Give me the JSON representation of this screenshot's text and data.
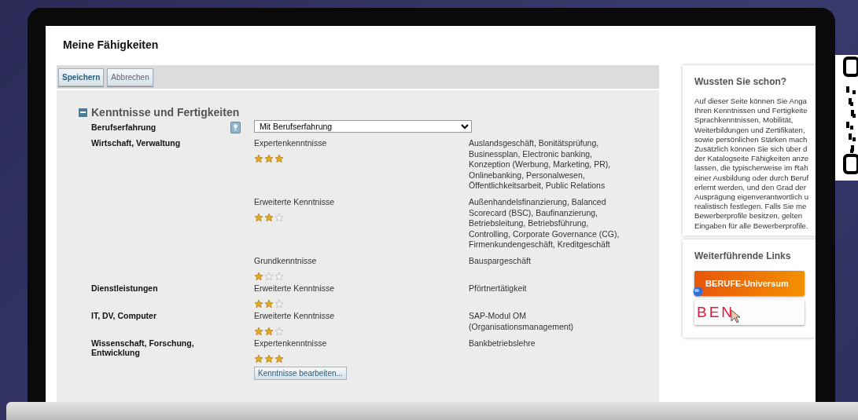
{
  "page": {
    "title": "Meine Fähigkeiten"
  },
  "toolbar": {
    "buttons": [
      "Speichern",
      "Abbrechen"
    ]
  },
  "section": {
    "title": "Kenntnisse und Fertigkeiten",
    "expanded": true,
    "experience": {
      "label": "Berufserfahrung",
      "value": "Mit Berufserfahrung"
    },
    "skills": [
      {
        "category": "Wirtschaft, Verwaltung",
        "level": "Expertenkenntnisse",
        "stars": 3,
        "items": "Auslandsgeschäft, Bonitätsprüfung, Businessplan, Electronic banking, Konzeption (Werbung, Marketing, PR), Onlinebanking, Personalwesen, Öffentlichkeitsarbeit, Public Relations"
      },
      {
        "level": "Erweiterte Kenntnisse",
        "stars": 2,
        "items": "Außenhandelsfinanzierung, Balanced Scorecard (BSC), Baufinanzierung, Betriebsleitung, Betriebsführung, Controlling, Corporate Governance (CG), Firmenkundengeschäft, Kreditgeschäft"
      },
      {
        "level": "Grundkenntnisse",
        "stars": 1,
        "items": "Bauspargeschäft"
      },
      {
        "category": "Dienstleistungen",
        "level": "Erweiterte Kenntnisse",
        "stars": 2,
        "items": "Pförtnertätigkeit"
      },
      {
        "category": "IT, DV, Computer",
        "level": "Erweiterte Kenntnisse",
        "stars": 2,
        "items": "SAP-Modul OM (Organisationsmanagement)"
      },
      {
        "category": "Wissenschaft, Forschung, Entwicklung",
        "level": "Expertenkenntnisse",
        "stars": 3,
        "items": "Bankbetriebslehre"
      }
    ],
    "edit_button": "Kenntnisse bearbeiten..."
  },
  "sidebar": {
    "info": {
      "title": "Wussten Sie schon?",
      "lines": [
        "Auf dieser Seite können Sie Anga",
        "Ihren Kenntnissen und Fertigkeite",
        "Sprachkenntnissen, Mobilität,",
        "Weiterbildungen und Zertifikaten,",
        "sowie persönlichen Stärken mach",
        "Zusätzlich können Sie sich über d",
        "der Katalogseite Fähigkeiten anze",
        "lassen, die typischerweise im Rah",
        "einer Ausbildung oder durch Beruf",
        "erlernt werden, und den Grad der",
        "Ausprägung eigenverantwortlich u",
        "realistisch festlegen. Falls Sie me",
        "Bewerberprofile besitzen, gelten",
        "Eingaben für alle Bewerberprofile."
      ]
    },
    "links": {
      "title": "Weiterführende Links",
      "items": [
        {
          "kind": "orange",
          "label": "BERUFE-Universum"
        },
        {
          "kind": "plain",
          "label": "BEN"
        }
      ]
    }
  }
}
